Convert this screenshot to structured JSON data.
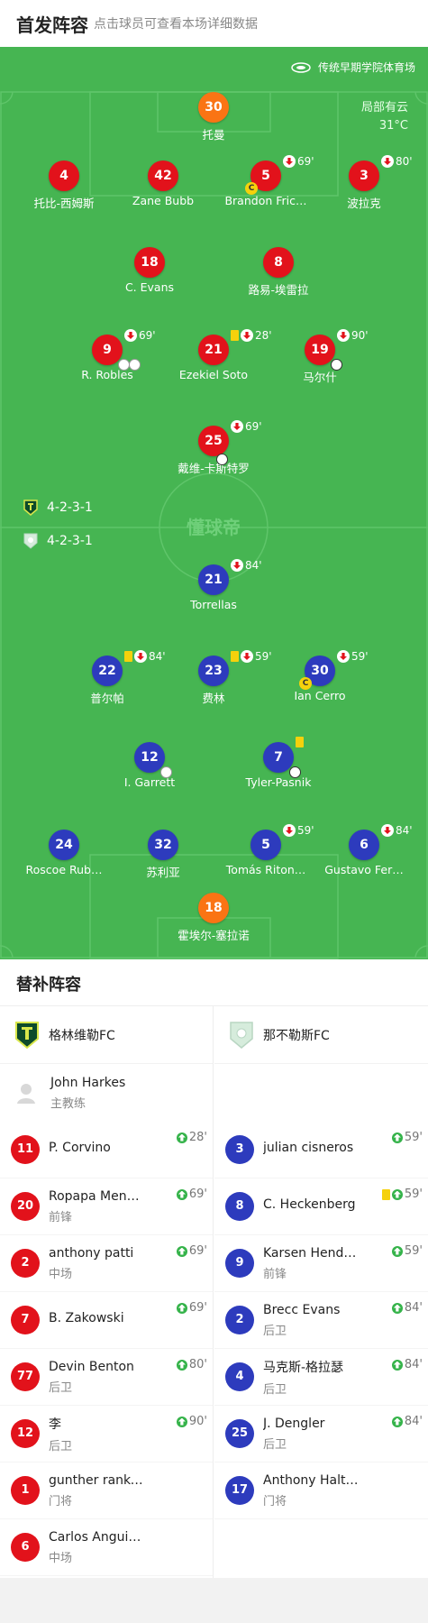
{
  "header": {
    "title": "首发阵容",
    "subtitle": "点击球员可查看本场详细数据"
  },
  "pitch": {
    "stadium": "传统早期学院体育场",
    "weather": "局部有云",
    "temperature": "31°C",
    "watermark": "懂球帝",
    "home_formation": "4-2-3-1",
    "away_formation": "4-2-3-1"
  },
  "home_players": [
    {
      "num": "30",
      "name": "托曼",
      "color": "orange"
    },
    {
      "num": "4",
      "name": "托比-西姆斯",
      "color": "red"
    },
    {
      "num": "42",
      "name": "Zane Bubb",
      "color": "red"
    },
    {
      "num": "5",
      "name": "Brandon Fric…",
      "color": "red",
      "minute": "69'"
    },
    {
      "num": "3",
      "name": "波拉克",
      "color": "red",
      "minute": "80'"
    },
    {
      "num": "18",
      "name": "C. Evans",
      "color": "red"
    },
    {
      "num": "8",
      "name": "路易-埃雷拉",
      "color": "red"
    },
    {
      "num": "9",
      "name": "R. Robles",
      "color": "red",
      "minute": "69'"
    },
    {
      "num": "21",
      "name": "Ezekiel Soto",
      "color": "red",
      "minute": "28'"
    },
    {
      "num": "19",
      "name": "马尔什",
      "color": "red",
      "minute": "90'"
    },
    {
      "num": "25",
      "name": "戴维-卡斯特罗",
      "color": "red",
      "minute": "69'"
    }
  ],
  "away_players": [
    {
      "num": "21",
      "name": "Torrellas",
      "color": "blue",
      "minute": "84'"
    },
    {
      "num": "22",
      "name": "普尔帕",
      "color": "blue",
      "minute": "84'"
    },
    {
      "num": "23",
      "name": "费林",
      "color": "blue",
      "minute": "59'"
    },
    {
      "num": "30",
      "name": "Ian Cerro",
      "color": "blue",
      "minute": "59'"
    },
    {
      "num": "12",
      "name": "I. Garrett",
      "color": "blue"
    },
    {
      "num": "7",
      "name": "Tyler-Pasnik",
      "color": "blue"
    },
    {
      "num": "24",
      "name": "Roscoe Rub…",
      "color": "blue"
    },
    {
      "num": "32",
      "name": "苏利亚",
      "color": "blue"
    },
    {
      "num": "5",
      "name": "Tomás Riton…",
      "color": "blue",
      "minute": "59'"
    },
    {
      "num": "6",
      "name": "Gustavo Fer…",
      "color": "blue",
      "minute": "84'"
    },
    {
      "num": "18",
      "name": "霍埃尔-塞拉诺",
      "color": "orange"
    }
  ],
  "captain_mark": "C",
  "subs": {
    "title": "替补阵容",
    "home_team": "格林维勒FC",
    "away_team": "那不勒斯FC",
    "coach": {
      "name": "John Harkes",
      "role": "主教练"
    },
    "home": [
      {
        "num": "11",
        "name": "P. Corvino",
        "role": "",
        "minute": "28'"
      },
      {
        "num": "20",
        "name": "Ropapa Men…",
        "role": "前锋",
        "minute": "69'"
      },
      {
        "num": "2",
        "name": "anthony patti",
        "role": "中场",
        "minute": "69'"
      },
      {
        "num": "7",
        "name": "B. Zakowski",
        "role": "",
        "minute": "69'"
      },
      {
        "num": "77",
        "name": "Devin Benton",
        "role": "后卫",
        "minute": "80'"
      },
      {
        "num": "12",
        "name": "李",
        "role": "后卫",
        "minute": "90'"
      },
      {
        "num": "1",
        "name": "gunther ranke…",
        "role": "门将",
        "minute": ""
      },
      {
        "num": "6",
        "name": "Carlos Anguia…",
        "role": "中场",
        "minute": ""
      }
    ],
    "away": [
      {
        "num": "3",
        "name": "julian cisneros",
        "role": "",
        "minute": "59'"
      },
      {
        "num": "8",
        "name": "C. Heckenberg",
        "role": "",
        "minute": "59'"
      },
      {
        "num": "9",
        "name": "Karsen Hend…",
        "role": "前锋",
        "minute": "59'"
      },
      {
        "num": "2",
        "name": "Brecc Evans",
        "role": "后卫",
        "minute": "84'"
      },
      {
        "num": "4",
        "name": "马克斯-格拉瑟",
        "role": "后卫",
        "minute": "84'"
      },
      {
        "num": "25",
        "name": "J. Dengler",
        "role": "后卫",
        "minute": "84'"
      },
      {
        "num": "17",
        "name": "Anthony Halt…",
        "role": "门将",
        "minute": ""
      }
    ]
  },
  "colors": {
    "pitch": "#46b552",
    "home": "#e2121b",
    "away": "#2d3bbd",
    "goalkeeper": "#fa7414",
    "yellow_card": "#f5d10c",
    "sub_in": "#35b34a"
  }
}
